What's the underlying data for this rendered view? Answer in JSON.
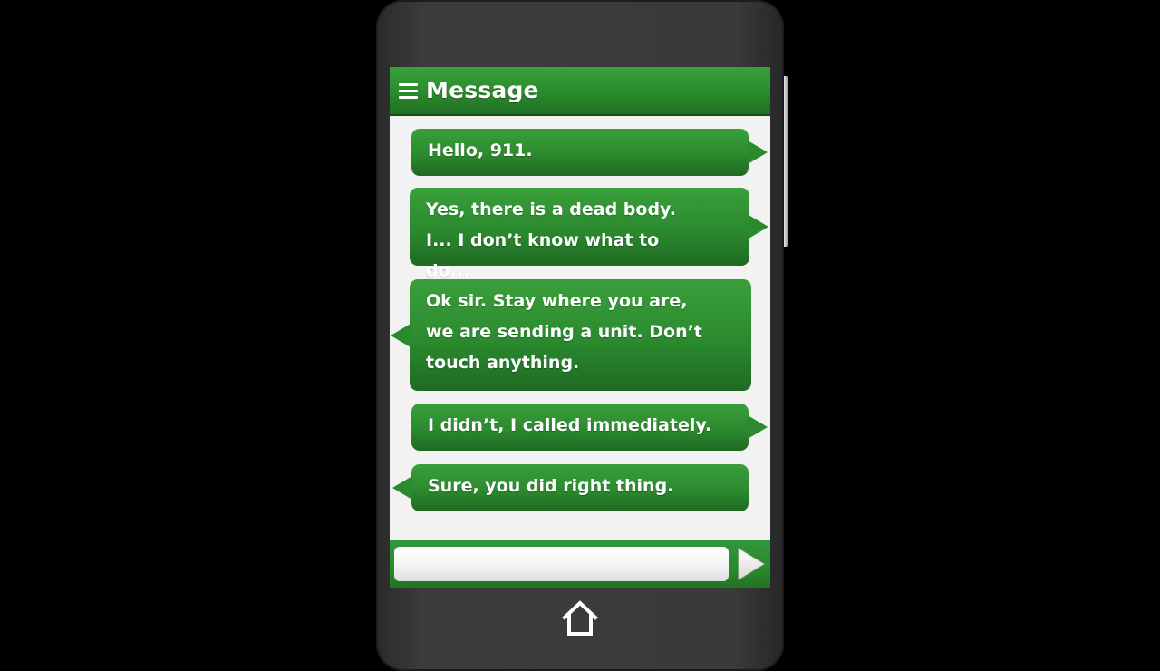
{
  "header": {
    "title": "Message",
    "menu_icon": "hamburger-menu-icon"
  },
  "messages": [
    {
      "direction": "outgoing",
      "text": "Hello, 911."
    },
    {
      "direction": "outgoing",
      "text": "Yes, there is a dead body. I... I don’t know what to do..."
    },
    {
      "direction": "incoming",
      "text": "Ok sir. Stay where you are, we are sending a unit. Don’t touch anything."
    },
    {
      "direction": "outgoing",
      "text": "I didn’t, I called immediately."
    },
    {
      "direction": "incoming",
      "text": "Sure, you did right thing."
    }
  ],
  "composer": {
    "value": "",
    "placeholder": "",
    "send_icon": "send-arrow-icon"
  },
  "home_icon": "home-icon",
  "colors": {
    "accent": "#2b8a2e",
    "accent_dark": "#1f6a23",
    "screen_background": "#f2f2f2",
    "phone_body": "#3a3a3a",
    "page_background": "#000000"
  }
}
